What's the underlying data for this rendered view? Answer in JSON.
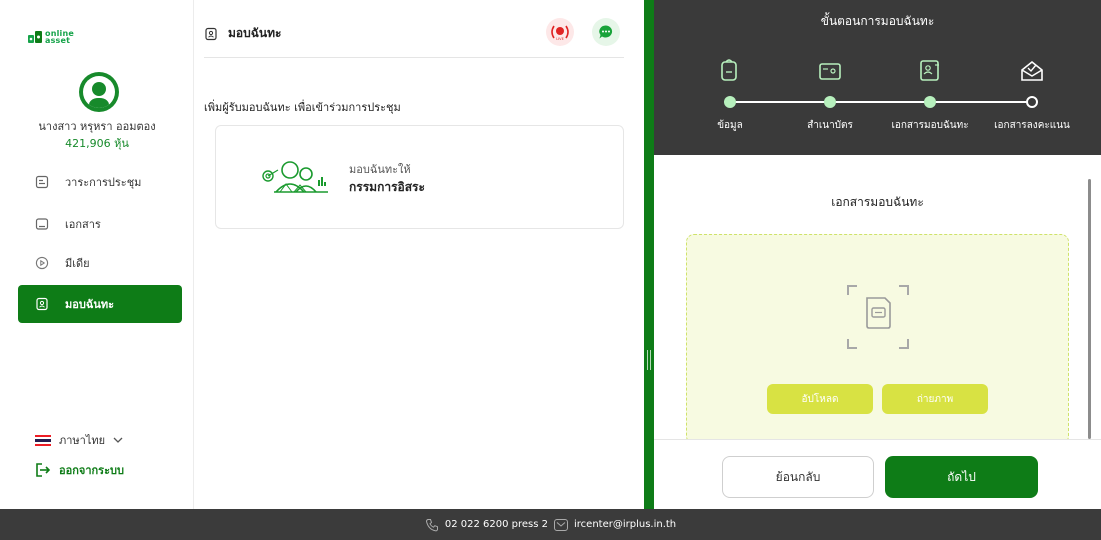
{
  "app": {
    "logo_text_top": "online",
    "logo_text_bottom": "asset"
  },
  "user": {
    "name": "นางสาว หรุหรา ออมตอง",
    "shares": "421,906 หุ้น"
  },
  "sidebar": {
    "items": [
      {
        "label": "วาระการประชุม",
        "icon": "agenda-icon"
      },
      {
        "label": "เอกสาร",
        "icon": "folder-icon"
      },
      {
        "label": "มีเดีย",
        "icon": "play-icon"
      },
      {
        "label": "มอบฉันทะ",
        "icon": "proxy-icon",
        "active": true
      }
    ],
    "language": "ภาษาไทย",
    "logout": "ออกจากระบบ"
  },
  "main": {
    "title": "มอบฉันทะ",
    "live_badge": "LIVE",
    "heading": "เพิ่มผู้รับมอบฉันทะ เพื่อเข้าร่วมการประชุม",
    "card": {
      "to_label": "มอบฉันทะให้",
      "recipient": "กรรมการอิสระ"
    }
  },
  "steps": {
    "title": "ขั้นตอนการมอบฉันทะ",
    "items": [
      {
        "label": "ข้อมูล",
        "state": "done"
      },
      {
        "label": "สำเนาบัตร",
        "state": "done"
      },
      {
        "label": "เอกสารมอบฉันทะ",
        "state": "current"
      },
      {
        "label": "เอกสารลงคะแนน",
        "state": "pending"
      }
    ]
  },
  "document": {
    "title": "เอกสารมอบฉันทะ",
    "upload_label": "อัปโหลด",
    "camera_label": "ถ่ายภาพ"
  },
  "actions": {
    "back_label": "ย้อนกลับ",
    "next_label": "ถัดไป"
  },
  "footer": {
    "phone": "02 022 6200 press 2",
    "email": "ircenter@irplus.in.th"
  },
  "colors": {
    "primary": "#0e7c17",
    "dark_bar": "#3a3a3a",
    "accent_yellow": "#d8e243",
    "live_red": "#e02424"
  }
}
